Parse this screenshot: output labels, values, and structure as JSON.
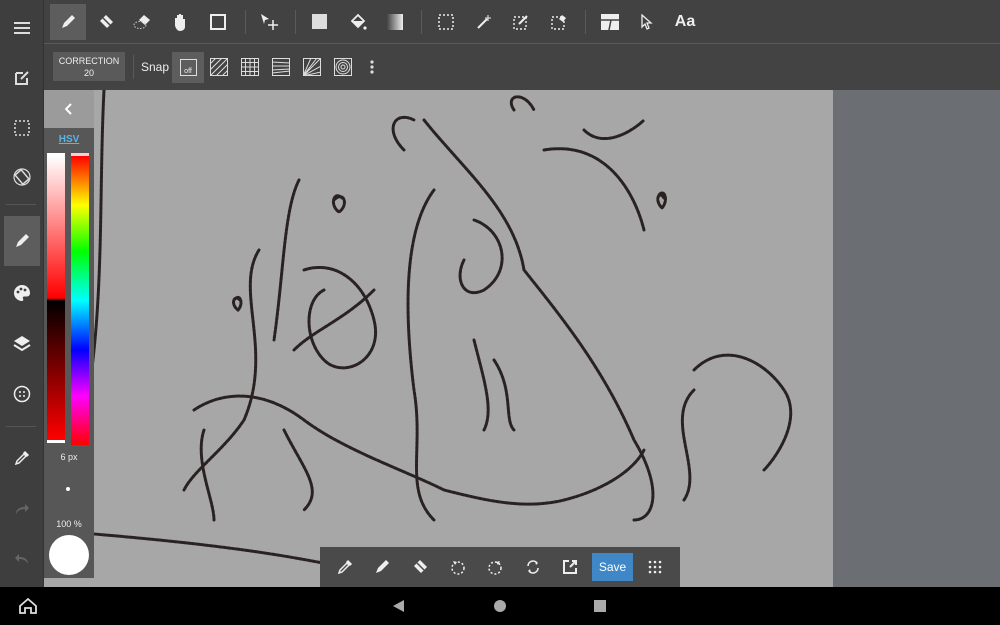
{
  "toolbar": {
    "tools": [
      "pen",
      "eraser",
      "blur-eraser",
      "hand",
      "rectangle",
      "move",
      "fill-rect",
      "bucket",
      "gradient",
      "select",
      "magic-wand",
      "select-pen",
      "select-eraser",
      "divide",
      "operation",
      "text"
    ],
    "text_label": "Aa"
  },
  "subbar": {
    "correction_label": "CORRECTION",
    "correction_value": "20",
    "snap_label": "Snap",
    "snap_off": "off"
  },
  "color_panel": {
    "mode": "HSV",
    "brush_size": "6 px",
    "opacity": "100 %",
    "current_color": "#ffffff",
    "mode_color": "#5ab4e6"
  },
  "bottombar": {
    "save_label": "Save",
    "save_color": "#3f87c7"
  }
}
